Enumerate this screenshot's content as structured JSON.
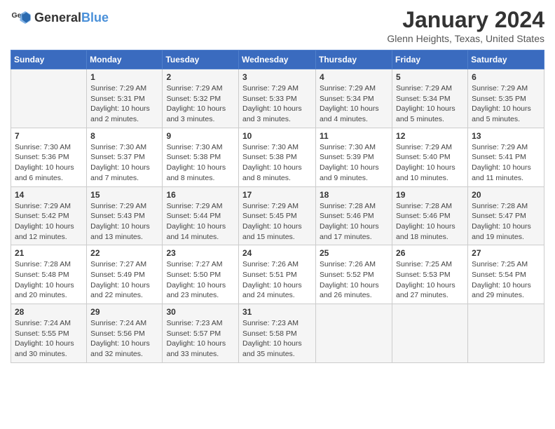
{
  "header": {
    "logo_general": "General",
    "logo_blue": "Blue",
    "month_year": "January 2024",
    "location": "Glenn Heights, Texas, United States"
  },
  "weekdays": [
    "Sunday",
    "Monday",
    "Tuesday",
    "Wednesday",
    "Thursday",
    "Friday",
    "Saturday"
  ],
  "weeks": [
    [
      {
        "day": "",
        "info": ""
      },
      {
        "day": "1",
        "info": "Sunrise: 7:29 AM\nSunset: 5:31 PM\nDaylight: 10 hours\nand 2 minutes."
      },
      {
        "day": "2",
        "info": "Sunrise: 7:29 AM\nSunset: 5:32 PM\nDaylight: 10 hours\nand 3 minutes."
      },
      {
        "day": "3",
        "info": "Sunrise: 7:29 AM\nSunset: 5:33 PM\nDaylight: 10 hours\nand 3 minutes."
      },
      {
        "day": "4",
        "info": "Sunrise: 7:29 AM\nSunset: 5:34 PM\nDaylight: 10 hours\nand 4 minutes."
      },
      {
        "day": "5",
        "info": "Sunrise: 7:29 AM\nSunset: 5:34 PM\nDaylight: 10 hours\nand 5 minutes."
      },
      {
        "day": "6",
        "info": "Sunrise: 7:29 AM\nSunset: 5:35 PM\nDaylight: 10 hours\nand 5 minutes."
      }
    ],
    [
      {
        "day": "7",
        "info": "Sunrise: 7:30 AM\nSunset: 5:36 PM\nDaylight: 10 hours\nand 6 minutes."
      },
      {
        "day": "8",
        "info": "Sunrise: 7:30 AM\nSunset: 5:37 PM\nDaylight: 10 hours\nand 7 minutes."
      },
      {
        "day": "9",
        "info": "Sunrise: 7:30 AM\nSunset: 5:38 PM\nDaylight: 10 hours\nand 8 minutes."
      },
      {
        "day": "10",
        "info": "Sunrise: 7:30 AM\nSunset: 5:38 PM\nDaylight: 10 hours\nand 8 minutes."
      },
      {
        "day": "11",
        "info": "Sunrise: 7:30 AM\nSunset: 5:39 PM\nDaylight: 10 hours\nand 9 minutes."
      },
      {
        "day": "12",
        "info": "Sunrise: 7:29 AM\nSunset: 5:40 PM\nDaylight: 10 hours\nand 10 minutes."
      },
      {
        "day": "13",
        "info": "Sunrise: 7:29 AM\nSunset: 5:41 PM\nDaylight: 10 hours\nand 11 minutes."
      }
    ],
    [
      {
        "day": "14",
        "info": "Sunrise: 7:29 AM\nSunset: 5:42 PM\nDaylight: 10 hours\nand 12 minutes."
      },
      {
        "day": "15",
        "info": "Sunrise: 7:29 AM\nSunset: 5:43 PM\nDaylight: 10 hours\nand 13 minutes."
      },
      {
        "day": "16",
        "info": "Sunrise: 7:29 AM\nSunset: 5:44 PM\nDaylight: 10 hours\nand 14 minutes."
      },
      {
        "day": "17",
        "info": "Sunrise: 7:29 AM\nSunset: 5:45 PM\nDaylight: 10 hours\nand 15 minutes."
      },
      {
        "day": "18",
        "info": "Sunrise: 7:28 AM\nSunset: 5:46 PM\nDaylight: 10 hours\nand 17 minutes."
      },
      {
        "day": "19",
        "info": "Sunrise: 7:28 AM\nSunset: 5:46 PM\nDaylight: 10 hours\nand 18 minutes."
      },
      {
        "day": "20",
        "info": "Sunrise: 7:28 AM\nSunset: 5:47 PM\nDaylight: 10 hours\nand 19 minutes."
      }
    ],
    [
      {
        "day": "21",
        "info": "Sunrise: 7:28 AM\nSunset: 5:48 PM\nDaylight: 10 hours\nand 20 minutes."
      },
      {
        "day": "22",
        "info": "Sunrise: 7:27 AM\nSunset: 5:49 PM\nDaylight: 10 hours\nand 22 minutes."
      },
      {
        "day": "23",
        "info": "Sunrise: 7:27 AM\nSunset: 5:50 PM\nDaylight: 10 hours\nand 23 minutes."
      },
      {
        "day": "24",
        "info": "Sunrise: 7:26 AM\nSunset: 5:51 PM\nDaylight: 10 hours\nand 24 minutes."
      },
      {
        "day": "25",
        "info": "Sunrise: 7:26 AM\nSunset: 5:52 PM\nDaylight: 10 hours\nand 26 minutes."
      },
      {
        "day": "26",
        "info": "Sunrise: 7:25 AM\nSunset: 5:53 PM\nDaylight: 10 hours\nand 27 minutes."
      },
      {
        "day": "27",
        "info": "Sunrise: 7:25 AM\nSunset: 5:54 PM\nDaylight: 10 hours\nand 29 minutes."
      }
    ],
    [
      {
        "day": "28",
        "info": "Sunrise: 7:24 AM\nSunset: 5:55 PM\nDaylight: 10 hours\nand 30 minutes."
      },
      {
        "day": "29",
        "info": "Sunrise: 7:24 AM\nSunset: 5:56 PM\nDaylight: 10 hours\nand 32 minutes."
      },
      {
        "day": "30",
        "info": "Sunrise: 7:23 AM\nSunset: 5:57 PM\nDaylight: 10 hours\nand 33 minutes."
      },
      {
        "day": "31",
        "info": "Sunrise: 7:23 AM\nSunset: 5:58 PM\nDaylight: 10 hours\nand 35 minutes."
      },
      {
        "day": "",
        "info": ""
      },
      {
        "day": "",
        "info": ""
      },
      {
        "day": "",
        "info": ""
      }
    ]
  ]
}
